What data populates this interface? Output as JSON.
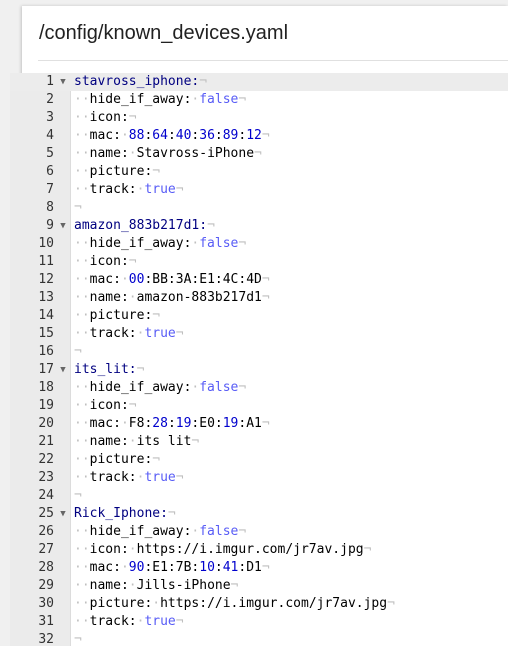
{
  "header": {
    "file_path": "/config/known_devices.yaml"
  },
  "editor": {
    "lines": [
      {
        "n": "1",
        "fold": true,
        "indent": 0,
        "text": "stavross_iphone:"
      },
      {
        "n": "2",
        "indent": 2,
        "text": "hide_if_away: false"
      },
      {
        "n": "3",
        "indent": 2,
        "text": "icon:"
      },
      {
        "n": "4",
        "indent": 2,
        "text": "mac: 88:64:40:36:89:12"
      },
      {
        "n": "5",
        "indent": 2,
        "text": "name: Stavross-iPhone"
      },
      {
        "n": "6",
        "indent": 2,
        "text": "picture:"
      },
      {
        "n": "7",
        "indent": 2,
        "text": "track: true"
      },
      {
        "n": "8",
        "indent": 0,
        "text": ""
      },
      {
        "n": "9",
        "fold": true,
        "indent": 0,
        "text": "amazon_883b217d1:"
      },
      {
        "n": "10",
        "indent": 2,
        "text": "hide_if_away: false"
      },
      {
        "n": "11",
        "indent": 2,
        "text": "icon:"
      },
      {
        "n": "12",
        "indent": 2,
        "text": "mac: 00:BB:3A:E1:4C:4D"
      },
      {
        "n": "13",
        "indent": 2,
        "text": "name: amazon-883b217d1"
      },
      {
        "n": "14",
        "indent": 2,
        "text": "picture:"
      },
      {
        "n": "15",
        "indent": 2,
        "text": "track: true"
      },
      {
        "n": "16",
        "indent": 0,
        "text": ""
      },
      {
        "n": "17",
        "fold": true,
        "indent": 0,
        "text": "its_lit:"
      },
      {
        "n": "18",
        "indent": 2,
        "text": "hide_if_away: false"
      },
      {
        "n": "19",
        "indent": 2,
        "text": "icon:"
      },
      {
        "n": "20",
        "indent": 2,
        "text": "mac: F8:28:19:E0:19:A1"
      },
      {
        "n": "21",
        "indent": 2,
        "text": "name: its lit"
      },
      {
        "n": "22",
        "indent": 2,
        "text": "picture:"
      },
      {
        "n": "23",
        "indent": 2,
        "text": "track: true"
      },
      {
        "n": "24",
        "indent": 0,
        "text": ""
      },
      {
        "n": "25",
        "fold": true,
        "indent": 0,
        "text": "Rick_Iphone:"
      },
      {
        "n": "26",
        "indent": 2,
        "text": "hide_if_away: false"
      },
      {
        "n": "27",
        "indent": 2,
        "text": "icon: https://i.imgur.com/jr7av.jpg"
      },
      {
        "n": "28",
        "indent": 2,
        "text": "mac: 90:E1:7B:10:41:D1"
      },
      {
        "n": "29",
        "indent": 2,
        "text": "name: Jills-iPhone"
      },
      {
        "n": "30",
        "indent": 2,
        "text": "picture: https://i.imgur.com/jr7av.jpg"
      },
      {
        "n": "31",
        "indent": 2,
        "text": "track: true"
      },
      {
        "n": "32",
        "indent": 0,
        "text": ""
      }
    ]
  },
  "colors": {
    "key": "#000000",
    "boolean": "#585cf6",
    "number": "#0000cd",
    "whitespace_marker": "#bfbfbf"
  },
  "icons": {
    "fold": "fold-arrow-icon"
  }
}
